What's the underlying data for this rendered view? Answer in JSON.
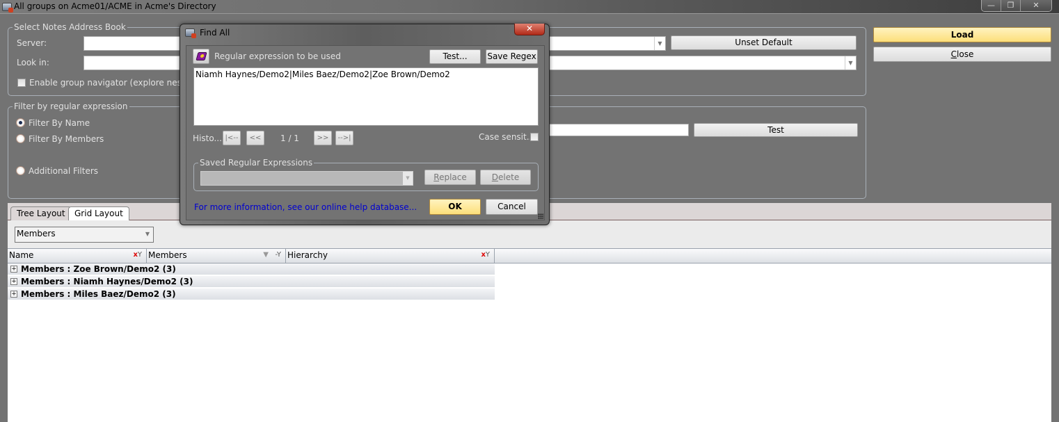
{
  "window": {
    "title": "All groups on Acme01/ACME in Acme's Directory",
    "controls": {
      "minimize": "—",
      "restore": "❐",
      "close": "✕"
    }
  },
  "address_book": {
    "legend": "Select Notes Address Book",
    "server_label": "Server:",
    "server_value": "",
    "look_in_label": "Look in:",
    "look_in_value": "",
    "unset_default": "Unset Default",
    "group_navigator_label": "Enable group navigator (explore nested g",
    "group_navigator_checked": false
  },
  "filter": {
    "legend": "Filter by regular expression",
    "options": [
      {
        "label": "Filter By Name",
        "selected": true
      },
      {
        "label": "Filter By Members",
        "selected": false
      },
      {
        "label": "Additional Filters",
        "selected": false
      }
    ],
    "regex_value": "",
    "test_button": "Test"
  },
  "actions": {
    "load": "Load",
    "close": "Close",
    "close_mnemonic": "C",
    "close_rest": "lose"
  },
  "tabs": [
    {
      "label": "Tree Layout",
      "active": false
    },
    {
      "label": "Grid Layout",
      "active": true
    }
  ],
  "grid": {
    "group_by": "Members",
    "columns": [
      "Name",
      "Members",
      "Hierarchy"
    ],
    "rows": [
      {
        "label": "Members : Zoe Brown/Demo2 (3)"
      },
      {
        "label": "Members : Niamh Haynes/Demo2 (3)"
      },
      {
        "label": "Members : Miles Baez/Demo2 (3)"
      }
    ]
  },
  "find_all": {
    "title": "Find All",
    "regex_label": "Regular expression to be used",
    "test_button": "Test...",
    "save_button": "Save Regex",
    "regex_value": "Niamh Haynes/Demo2|Miles Baez/Demo2|Zoe Brown/Demo2",
    "history_label": "Histo...",
    "nav": {
      "first": "|<--",
      "prev": "<<",
      "position": "1 / 1",
      "next": ">>",
      "last": "-->|"
    },
    "case_label": "Case sensit...",
    "case_checked": false,
    "saved_legend": "Saved Regular Expressions",
    "saved_value": "",
    "replace_button": {
      "mnemonic": "R",
      "rest": "eplace"
    },
    "delete_button": {
      "mnemonic": "D",
      "rest": "elete"
    },
    "help_link": "For more information, see our online help database...",
    "ok_button": "OK",
    "cancel_button": "Cancel"
  },
  "colors": {
    "background": "#737373",
    "primary_button": "#fcdf7a",
    "link": "#0000d0",
    "close_red": "#b02a18"
  }
}
